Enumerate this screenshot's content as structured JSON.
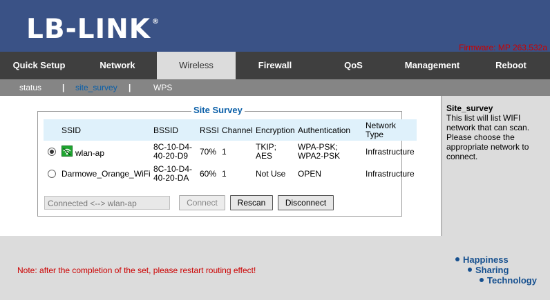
{
  "header": {
    "logo_text": "LB-LINK",
    "logo_mark": "®",
    "firmware": "Firmware: MP 263.532a"
  },
  "mainnav": [
    {
      "label": "Quick Setup"
    },
    {
      "label": "Network"
    },
    {
      "label": "Wireless"
    },
    {
      "label": "Firewall"
    },
    {
      "label": "QoS"
    },
    {
      "label": "Management"
    },
    {
      "label": "Reboot"
    }
  ],
  "subnav": {
    "status": "status",
    "site_survey": "site_survey",
    "wps": "WPS",
    "separator": "|"
  },
  "survey": {
    "title": "Site Survey",
    "columns": {
      "ssid": "SSID",
      "bssid": "BSSID",
      "rssi": "RSSI",
      "channel": "Channel",
      "encryption": "Encryption",
      "authentication": "Authentication",
      "network_type": "Network Type"
    },
    "rows": [
      {
        "selected": true,
        "ssid": "wlan-ap",
        "bssid": "8C-10-D4-40-20-D9",
        "rssi": "70%",
        "channel": "1",
        "encryption": "TKIP; AES",
        "authentication": "WPA-PSK; WPA2-PSK",
        "network_type": "Infrastructure"
      },
      {
        "selected": false,
        "ssid": "Darmowe_Orange_WiFi",
        "bssid": "8C-10-D4-40-20-DA",
        "rssi": "60%",
        "channel": "1",
        "encryption": "Not Use",
        "authentication": "OPEN",
        "network_type": "Infrastructure"
      }
    ],
    "connection_status": "Connected <--> wlan-ap",
    "connect_label": "Connect",
    "rescan_label": "Rescan",
    "disconnect_label": "Disconnect"
  },
  "help": {
    "title": "Site_survey",
    "text": "This list will list WIFI network that can scan. Please choose the appropriate network to connect."
  },
  "footer": {
    "note": "Note: after the completion of the set, please restart routing effect!",
    "slogan": [
      "Happiness",
      "Sharing",
      "Technology"
    ]
  },
  "colors": {
    "header_bg": "#3a5286",
    "nav_bg": "#3f3f3f",
    "accent_blue": "#0a5fa8",
    "alert_red": "#cc0000"
  },
  "icons": {
    "connected_network": "wifi-connected-icon"
  }
}
